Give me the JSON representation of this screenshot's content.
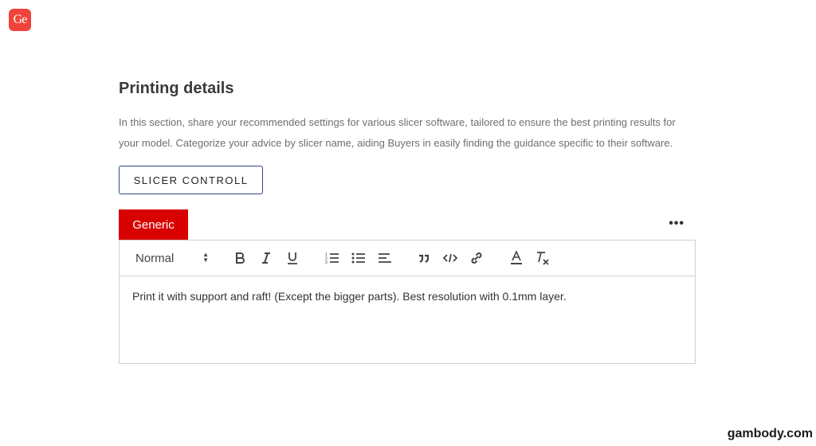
{
  "logo": {
    "text": "Ge"
  },
  "section": {
    "title": "Printing details",
    "description": "In this section, share your recommended settings for various slicer software, tailored to ensure the best printing results for your model. Categorize your advice by slicer name, aiding Buyers in easily finding the guidance specific to their software."
  },
  "slicer_button": {
    "label": "SLICER CONTROLL"
  },
  "tabs": [
    {
      "label": "Generic",
      "active": true
    }
  ],
  "more_menu": {
    "icon": "more-horizontal-icon",
    "glyph": "•••"
  },
  "toolbar": {
    "format": {
      "selected": "Normal"
    },
    "buttons": [
      {
        "icon": "bold-icon"
      },
      {
        "icon": "italic-icon"
      },
      {
        "icon": "underline-icon"
      },
      {
        "icon": "ordered-list-icon"
      },
      {
        "icon": "bullet-list-icon"
      },
      {
        "icon": "align-left-icon"
      },
      {
        "icon": "blockquote-icon"
      },
      {
        "icon": "code-icon"
      },
      {
        "icon": "link-icon"
      },
      {
        "icon": "text-color-icon"
      },
      {
        "icon": "clear-format-icon"
      }
    ]
  },
  "editor": {
    "content": "Print it with support and raft! (Except the bigger parts). Best resolution with 0.1mm layer."
  },
  "watermark": {
    "text": "gambody.com"
  },
  "colors": {
    "accent": "#d90000",
    "logo": "#f0433a",
    "button_border": "#2f4a7f"
  }
}
